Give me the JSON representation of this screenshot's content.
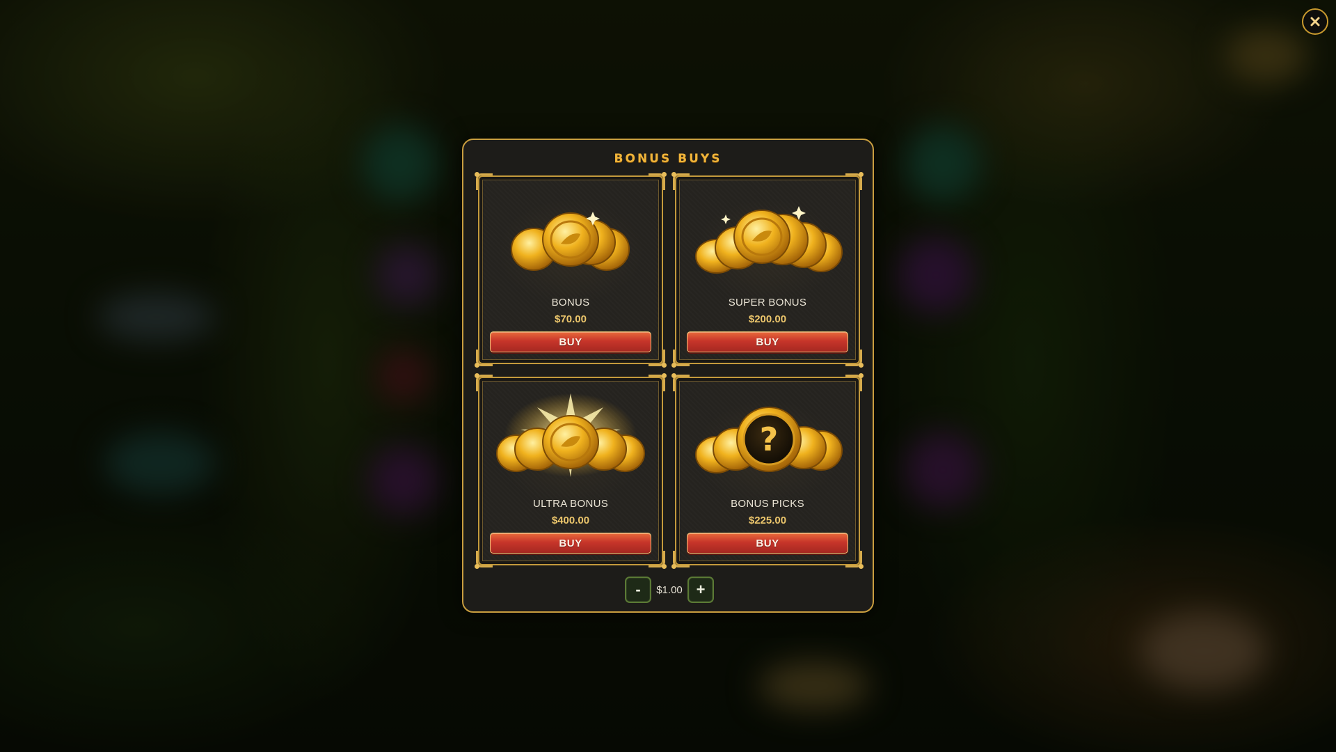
{
  "modal": {
    "title": "BONUS BUYS"
  },
  "bonus_options": [
    {
      "name": "BONUS",
      "price": "$70.00",
      "button_label": "BUY",
      "icon": "gold-coins-stack-icon"
    },
    {
      "name": "SUPER BONUS",
      "price": "$200.00",
      "button_label": "BUY",
      "icon": "gold-coins-pile-icon"
    },
    {
      "name": "ULTRA BONUS",
      "price": "$400.00",
      "button_label": "BUY",
      "icon": "glowing-gold-coins-icon"
    },
    {
      "name": "BONUS PICKS",
      "price": "$225.00",
      "button_label": "BUY",
      "icon": "mystery-coin-icon"
    }
  ],
  "bet": {
    "decrease_label": "-",
    "value": "$1.00",
    "increase_label": "+"
  },
  "controls": {
    "close_icon": "close-icon"
  },
  "colors": {
    "accent_gold": "#c99e3f",
    "title_gold": "#f0b43a",
    "price_gold": "#ecc66c",
    "buy_red": "#c7352a",
    "stepper_green": "#5b7a35",
    "modal_bg": "#1d1c19"
  }
}
